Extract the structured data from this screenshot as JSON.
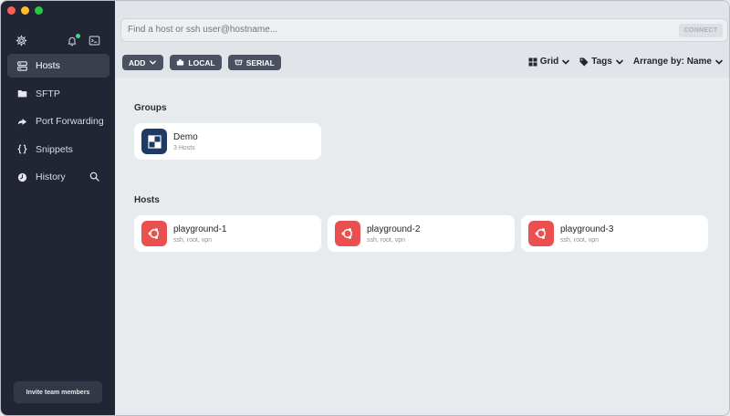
{
  "sidebar": {
    "nav": [
      {
        "label": "Hosts",
        "icon": "hosts-icon",
        "active": true
      },
      {
        "label": "SFTP",
        "icon": "folder-icon"
      },
      {
        "label": "Port Forwarding",
        "icon": "arrow-right-icon"
      },
      {
        "label": "Snippets",
        "icon": "braces-icon"
      },
      {
        "label": "History",
        "icon": "clock-icon"
      }
    ],
    "invite_label": "Invite team members"
  },
  "search": {
    "placeholder": "Find a host or ssh user@hostname...",
    "connect_label": "CONNECT"
  },
  "toolbar": {
    "add_label": "ADD",
    "local_label": "LOCAL",
    "serial_label": "SERIAL",
    "view_label": "Grid",
    "tags_label": "Tags",
    "arrange_label": "Arrange by: Name"
  },
  "groups": {
    "title": "Groups",
    "items": [
      {
        "name": "Demo",
        "subtitle": "3 Hosts"
      }
    ]
  },
  "hosts": {
    "title": "Hosts",
    "items": [
      {
        "name": "playground-1",
        "subtitle": "ssh, root, vpn"
      },
      {
        "name": "playground-2",
        "subtitle": "ssh, root, vpn"
      },
      {
        "name": "playground-3",
        "subtitle": "ssh, root, vpn"
      }
    ]
  },
  "colors": {
    "sidebar_bg": "#222634",
    "active_nav": "#3a3f4e",
    "group_tile": "#1f3b63",
    "host_tile": "#eb5050",
    "notification_dot": "#3ddc84"
  }
}
